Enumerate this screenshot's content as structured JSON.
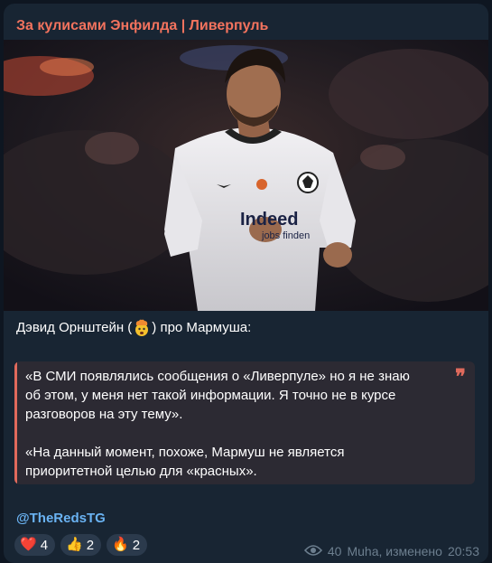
{
  "channel": {
    "title": "За кулисами Энфилда | Ливерпуль",
    "title_color": "#f3735e"
  },
  "photo": {
    "sponsor_text": "Indeed",
    "sponsor_sub": "jobs finden"
  },
  "message": {
    "intro_before": "Дэвид Орнштейн (",
    "intro_after": ") про Мармуша:",
    "quote_lines": [
      "«В СМИ появлялись сообщения о «Ливерпуле» но я не знаю",
      "об этом, у меня нет такой информации. Я точно не в курсе",
      "разговоров на эту тему»."
    ],
    "quote_lines_2": [
      "«На данный момент, похоже, Мармуш не является",
      "приоритетной целью для «красных»."
    ],
    "quote_mark": "❞",
    "handle": "@TheRedsTG"
  },
  "reactions": [
    {
      "emoji": "❤️",
      "count": "4",
      "icon": "heart-icon"
    },
    {
      "emoji": "👍",
      "count": "2",
      "icon": "thumbs-up-icon"
    },
    {
      "emoji": "🔥",
      "count": "2",
      "icon": "fire-icon"
    }
  ],
  "meta": {
    "views": "40",
    "author": "Muha, изменено",
    "time": "20:53"
  },
  "colors": {
    "background": "#0e1621",
    "bubble": "#182533",
    "link": "#6ab3f3",
    "quote_accent": "#e06a5c"
  }
}
